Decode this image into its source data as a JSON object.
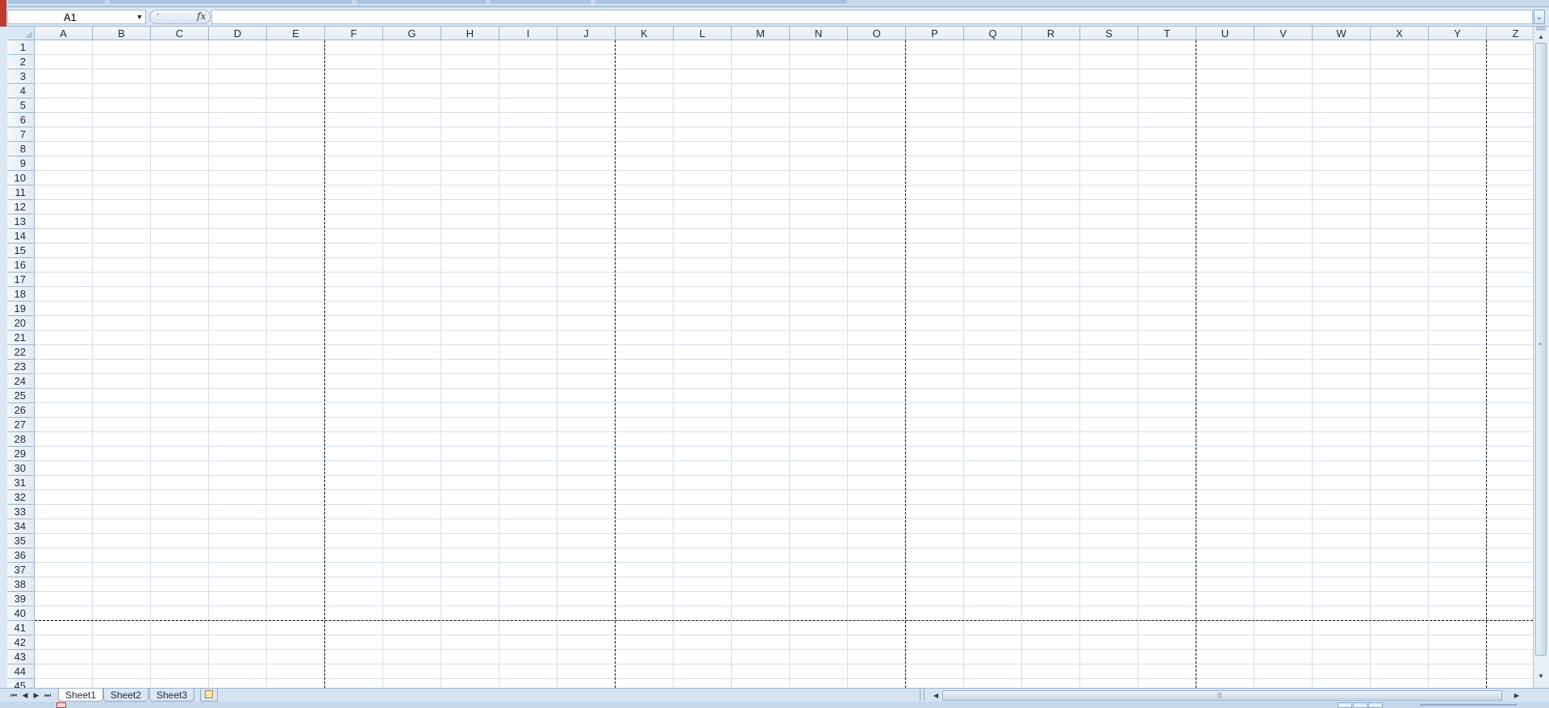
{
  "formula_bar": {
    "name_box_value": "A1",
    "fx_label": "fx",
    "formula_value": ""
  },
  "grid": {
    "columns": [
      "A",
      "B",
      "C",
      "D",
      "E",
      "F",
      "G",
      "H",
      "I",
      "J",
      "K",
      "L",
      "M",
      "N",
      "O",
      "P",
      "Q",
      "R",
      "S",
      "T",
      "U",
      "V",
      "W",
      "X",
      "Y",
      "Z"
    ],
    "rows": [
      "1",
      "2",
      "3",
      "4",
      "5",
      "6",
      "7",
      "8",
      "9",
      "10",
      "11",
      "12",
      "13",
      "14",
      "15",
      "16",
      "17",
      "18",
      "19",
      "20",
      "21",
      "22",
      "23",
      "24",
      "25",
      "26",
      "27",
      "28",
      "29",
      "30",
      "31",
      "32",
      "33",
      "34",
      "35",
      "36",
      "37",
      "38",
      "39",
      "40",
      "41",
      "42",
      "43",
      "44",
      "45"
    ],
    "page_break_after_columns": [
      "E",
      "J",
      "O",
      "T",
      "Y"
    ],
    "page_break_after_row": "40"
  },
  "sheet_tabs": {
    "tabs": [
      {
        "label": "Sheet1",
        "active": true
      },
      {
        "label": "Sheet2",
        "active": false
      },
      {
        "label": "Sheet3",
        "active": false
      }
    ],
    "nav_icons": [
      "first-sheet-icon",
      "prev-sheet-icon",
      "next-sheet-icon",
      "last-sheet-icon"
    ]
  },
  "colors": {
    "chrome": "#dde8f5",
    "gridline": "#d4dfec",
    "header_border": "#9eb6ce",
    "page_break": "#111111"
  }
}
